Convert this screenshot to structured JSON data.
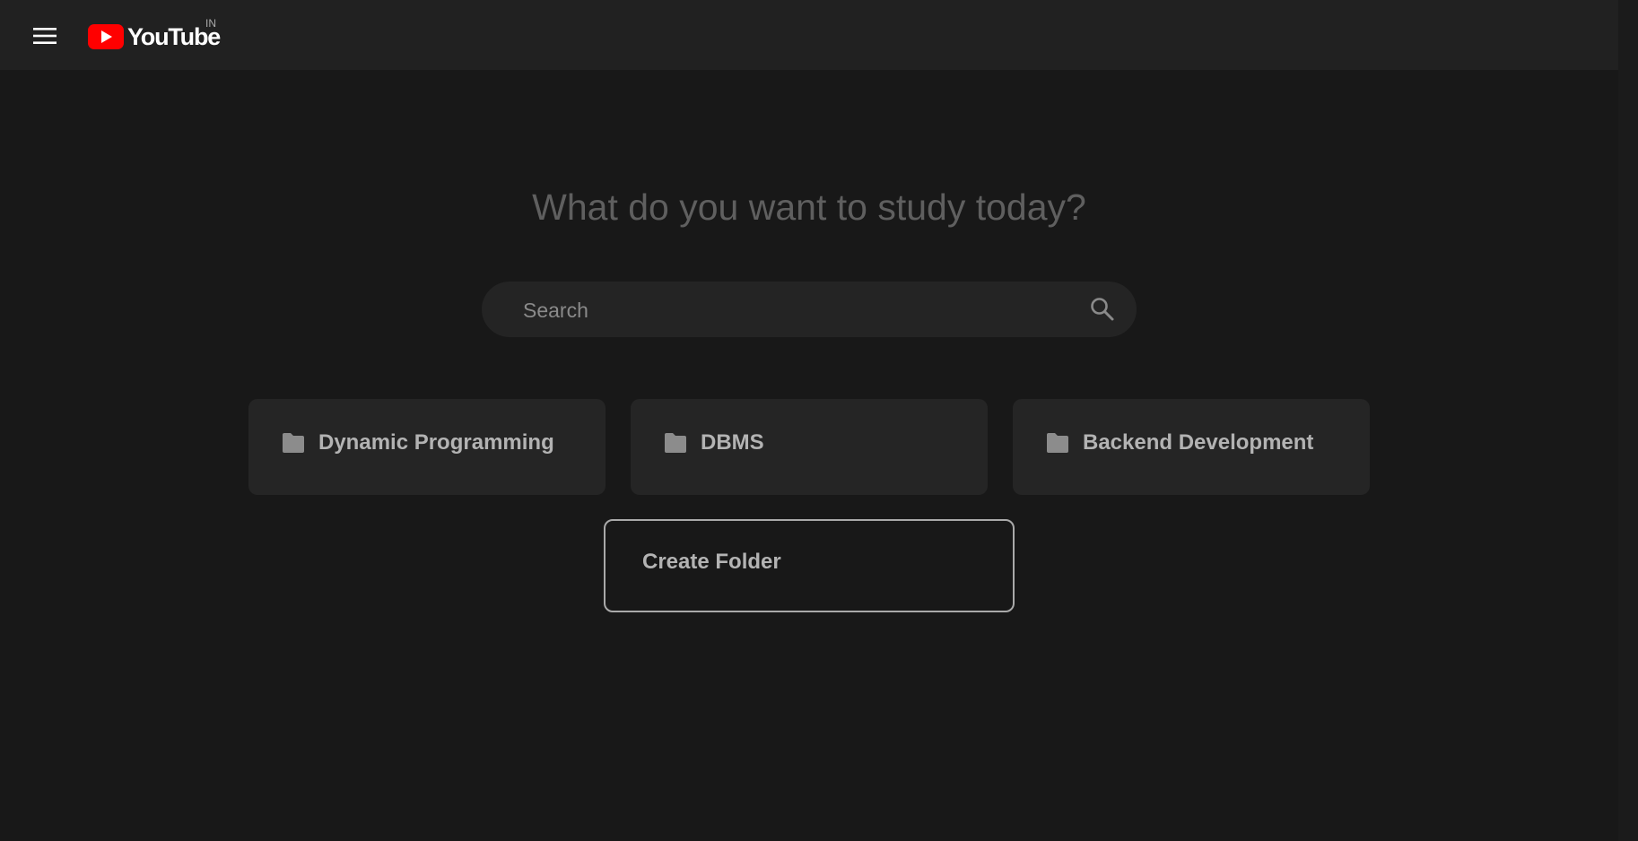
{
  "header": {
    "brand": "YouTube",
    "country_code": "IN",
    "icons": {
      "menu": "hamburger-menu-icon",
      "logo": "youtube-play-logo-icon"
    },
    "colors": {
      "brand_red": "#ff0000",
      "bar_bg": "#212121"
    }
  },
  "main": {
    "heading": "What do you want to study today?",
    "search": {
      "placeholder": "Search",
      "value": "",
      "icon": "search-icon"
    },
    "folders": [
      {
        "label": "Dynamic Programming",
        "icon": "folder-icon"
      },
      {
        "label": "DBMS",
        "icon": "folder-icon"
      },
      {
        "label": "Backend Development",
        "icon": "folder-icon"
      }
    ],
    "create_folder_label": "Create Folder"
  },
  "theme": {
    "page_bg": "#181818",
    "card_bg": "#252525",
    "text_muted": "#b3b3b3",
    "heading_color": "#5f5f5f"
  }
}
